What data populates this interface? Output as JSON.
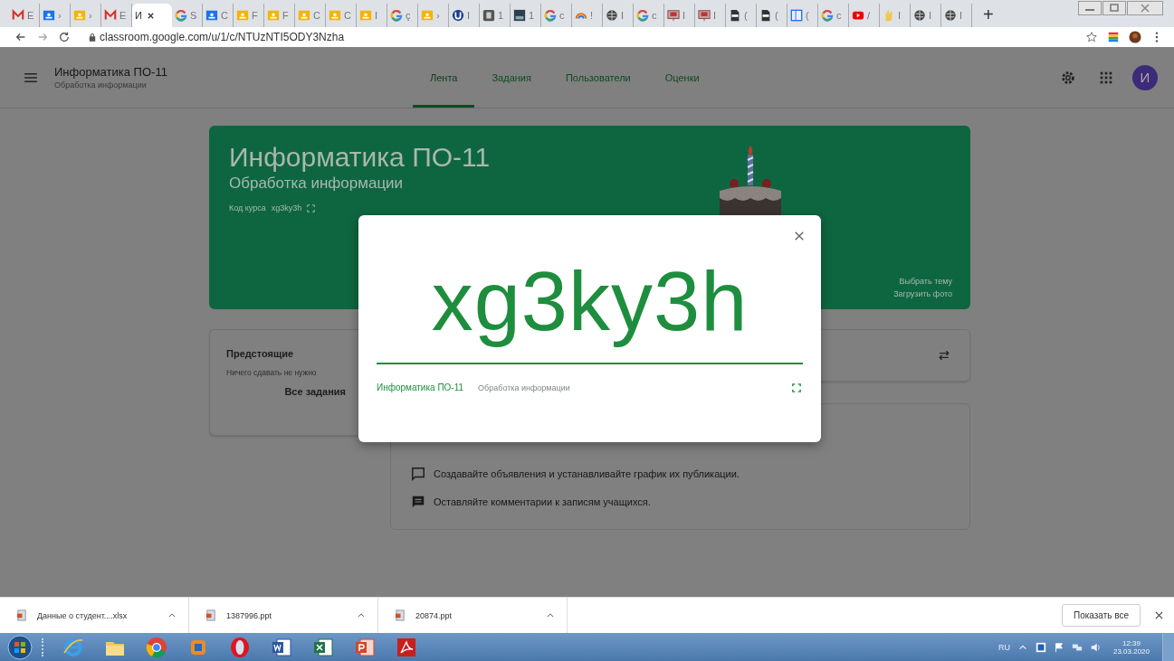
{
  "browser": {
    "tabs": [
      {
        "kind": "gmail",
        "title": "E",
        "selected": false
      },
      {
        "kind": "classroom",
        "color": "#1a73e8",
        "title": "›",
        "selected": false
      },
      {
        "kind": "classroom",
        "color": "#f4b400",
        "title": "›",
        "selected": false
      },
      {
        "kind": "gmail",
        "title": "E",
        "selected": false
      },
      {
        "kind": "none",
        "title": "И",
        "selected": true
      },
      {
        "kind": "google",
        "title": "S",
        "selected": false
      },
      {
        "kind": "classroom",
        "color": "#1a73e8",
        "title": "C",
        "selected": false
      },
      {
        "kind": "classroom",
        "color": "#f4b400",
        "title": "F",
        "selected": false
      },
      {
        "kind": "classroom",
        "color": "#f4b400",
        "title": "F",
        "selected": false
      },
      {
        "kind": "classroom",
        "color": "#f4b400",
        "title": "C",
        "selected": false
      },
      {
        "kind": "classroom",
        "color": "#f4b400",
        "title": "C",
        "selected": false
      },
      {
        "kind": "classroom",
        "color": "#f4b400",
        "title": "I",
        "selected": false
      },
      {
        "kind": "google",
        "title": "ç",
        "selected": false
      },
      {
        "kind": "classroom",
        "color": "#f4b400",
        "title": "›",
        "selected": false
      },
      {
        "kind": "shield",
        "title": "I",
        "selected": false
      },
      {
        "kind": "sheet",
        "title": "1",
        "selected": false
      },
      {
        "kind": "photo",
        "title": "1",
        "selected": false
      },
      {
        "kind": "google",
        "title": "c",
        "selected": false
      },
      {
        "kind": "rainbow",
        "title": "!",
        "selected": false
      },
      {
        "kind": "globe",
        "title": "I",
        "selected": false
      },
      {
        "kind": "google",
        "title": "c",
        "selected": false
      },
      {
        "kind": "slides",
        "title": "I",
        "selected": false
      },
      {
        "kind": "slides",
        "title": "I",
        "selected": false
      },
      {
        "kind": "pdf",
        "title": "(",
        "selected": false
      },
      {
        "kind": "pdf",
        "title": "(",
        "selected": false
      },
      {
        "kind": "panel",
        "title": "(",
        "selected": false
      },
      {
        "kind": "google",
        "title": "c",
        "selected": false
      },
      {
        "kind": "youtube",
        "title": "/",
        "selected": false
      },
      {
        "kind": "hand",
        "title": "I",
        "selected": false
      },
      {
        "kind": "globe",
        "title": "I",
        "selected": false
      },
      {
        "kind": "globe",
        "title": "I",
        "selected": false
      }
    ],
    "new_tab": "+",
    "address": "classroom.google.com/u/1/c/NTUzNTI5ODY3Nzha"
  },
  "app_header": {
    "course_title": "Информатика ПО-11",
    "course_subtitle": "Обработка информации",
    "nav": [
      {
        "label": "Лента",
        "selected": true
      },
      {
        "label": "Задания",
        "selected": false
      },
      {
        "label": "Пользователи",
        "selected": false
      },
      {
        "label": "Оценки",
        "selected": false
      }
    ],
    "avatar_letter": "И"
  },
  "banner": {
    "title": "Информатика ПО-11",
    "subtitle": "Обработка информации",
    "code_label": "Код курса",
    "code": "xg3ky3h",
    "links": [
      "Выбрать тему",
      "Загрузить фото"
    ]
  },
  "upcoming": {
    "title": "Предстоящие",
    "empty": "Ничего сдавать не нужно",
    "link": "Все задания"
  },
  "stream_tips": [
    {
      "kind": "announce",
      "text": "Создавайте объявления и устанавливайте график их публикации."
    },
    {
      "kind": "comment",
      "text": "Оставляйте комментарии к записям учащихся."
    }
  ],
  "dialog": {
    "code": "xg3ky3h",
    "course_title": "Информатика ПО-11",
    "course_subtitle": "Обработка информации"
  },
  "downloads": {
    "items": [
      {
        "name": "Данные о студент....xlsx"
      },
      {
        "name": "1387996.ppt"
      },
      {
        "name": "20874.ppt"
      }
    ],
    "show_all": "Показать все"
  },
  "taskbar": {
    "apps": [
      {
        "kind": "ie"
      },
      {
        "kind": "folder"
      },
      {
        "kind": "chrome"
      },
      {
        "kind": "media"
      },
      {
        "kind": "opera"
      },
      {
        "kind": "word"
      },
      {
        "kind": "excel"
      },
      {
        "kind": "powerpoint"
      },
      {
        "kind": "acrobat"
      }
    ],
    "language": "RU",
    "time": "12:39",
    "date": "23.03.2020"
  }
}
